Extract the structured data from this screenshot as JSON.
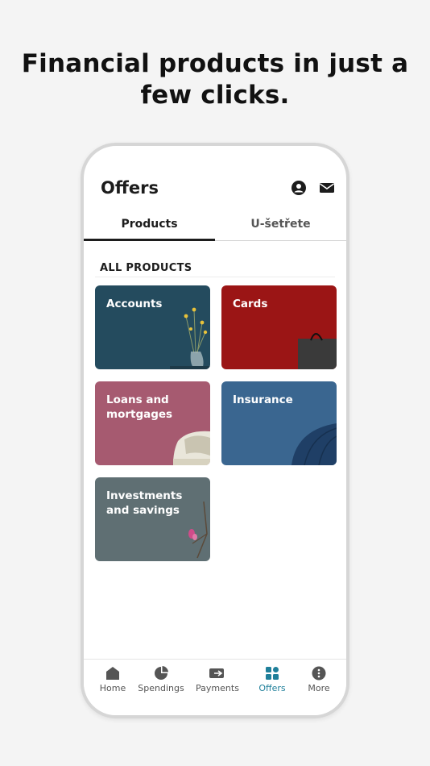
{
  "headline": "Financial products in just a few clicks.",
  "screen": {
    "title": "Offers",
    "icons": [
      "profile-icon",
      "mail-icon"
    ]
  },
  "tabs": [
    {
      "label": "Products",
      "active": true
    },
    {
      "label": "U-šetřete",
      "active": false
    }
  ],
  "section": {
    "label": "ALL PRODUCTS"
  },
  "products": [
    {
      "label": "Accounts",
      "color": "#244b5e"
    },
    {
      "label": "Cards",
      "color": "#9b1515"
    },
    {
      "label": "Loans and mortgages",
      "color": "#a65a70"
    },
    {
      "label": "Insurance",
      "color": "#3a6690"
    },
    {
      "label": "Investments and savings",
      "color": "#5f6f73"
    }
  ],
  "nav": [
    {
      "label": "Home",
      "icon": "home-icon",
      "active": false
    },
    {
      "label": "Spendings",
      "icon": "pie-chart-icon",
      "active": false
    },
    {
      "label": "Payments",
      "icon": "payments-icon",
      "active": false
    },
    {
      "label": "Offers",
      "icon": "offers-icon",
      "active": true
    },
    {
      "label": "More",
      "icon": "more-icon",
      "active": false
    }
  ],
  "colors": {
    "accent": "#1f7f9a",
    "text": "#1c1c1c"
  }
}
